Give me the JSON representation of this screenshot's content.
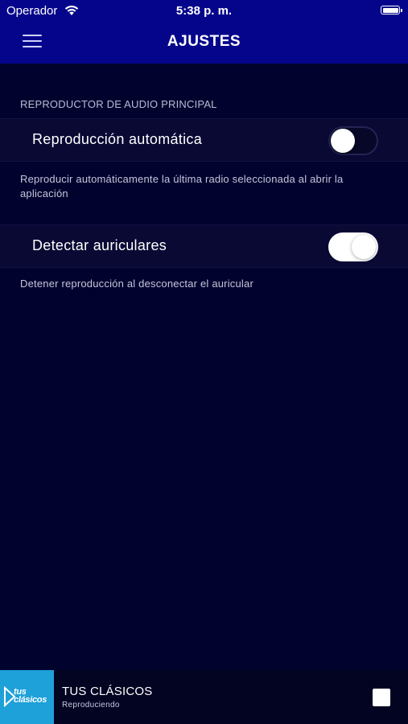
{
  "status_bar": {
    "carrier": "Operador",
    "time": "5:38 p. m.",
    "wifi_icon": "wifi-icon",
    "battery_icon": "battery-icon"
  },
  "nav": {
    "title": "AJUSTES",
    "menu_icon": "hamburger-menu-icon"
  },
  "colors": {
    "nav_background": "#05058c",
    "page_background": "#02022e",
    "row_background": "#090934",
    "logo_background": "#1ea0d8"
  },
  "settings": {
    "section_header": "REPRODUCTOR DE AUDIO PRINCIPAL",
    "autoplay": {
      "label": "Reproducción automática",
      "enabled": false,
      "description": "Reproducir automáticamente la última radio seleccionada al abrir la aplicación"
    },
    "headphones": {
      "label": "Detectar auriculares",
      "enabled": true,
      "description": "Detener reproducción al desconectar el auricular"
    }
  },
  "player": {
    "logo_text_line1": "tus",
    "logo_text_line2": "clásicos",
    "station_name": "TUS CLÁSICOS",
    "status": "Reproduciendo",
    "stop_icon": "stop-icon"
  }
}
